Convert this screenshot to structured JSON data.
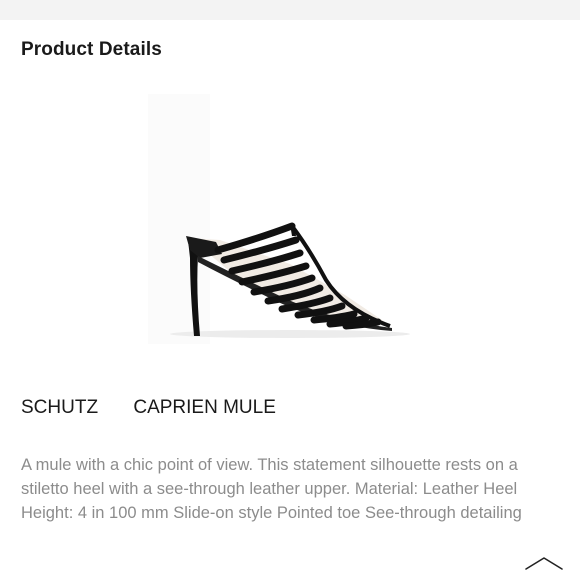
{
  "section": {
    "title": "Product Details"
  },
  "product": {
    "brand": "SCHUTZ",
    "name": "CAPRIEN MULE",
    "description": "A mule with a chic point of view. This statement silhouette rests on a stiletto heel with a see-through leather upper. Material: Leather Heel Height: 4 in 100 mm Slide-on style Pointed toe See-through detailing",
    "image_icon": "shoe-image",
    "shoe_color": "#111111"
  },
  "controls": {
    "collapse_icon": "chevron-up-icon"
  }
}
